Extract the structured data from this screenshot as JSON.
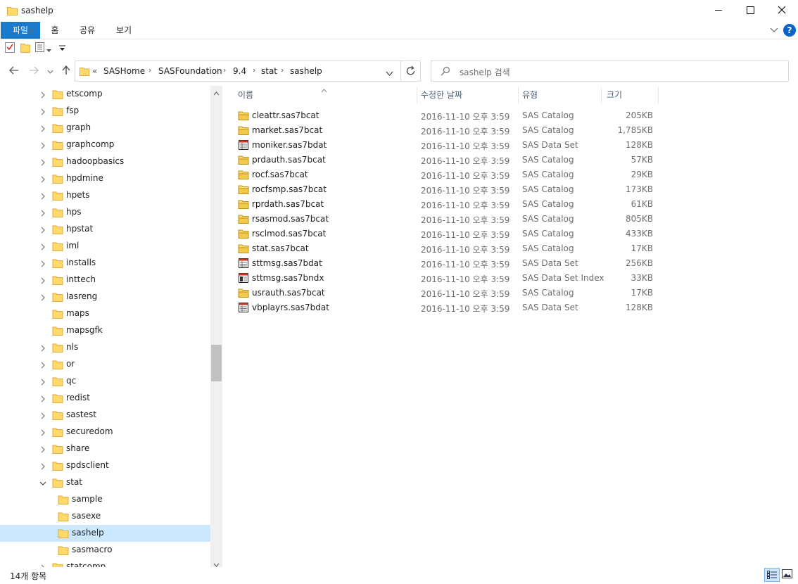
{
  "window": {
    "title": "sashelp",
    "controls": {
      "minimize": "minimize-icon",
      "maximize": "maximize-icon",
      "close": "close-icon"
    }
  },
  "ribbon": {
    "tabs": [
      {
        "label": "파일",
        "active": true
      },
      {
        "label": "홈"
      },
      {
        "label": "공유"
      },
      {
        "label": "보기"
      }
    ],
    "expand_icon": "chevron-down-icon",
    "help_icon": "help-icon",
    "help_label": "?"
  },
  "quick_access": [
    "properties-icon",
    "new-folder-icon",
    "view-options-icon",
    "customize-dropdown-icon"
  ],
  "address": {
    "prefix": "«",
    "breadcrumbs": [
      "SASHome",
      "SASFoundation",
      "9.4",
      "stat",
      "sashelp"
    ]
  },
  "search": {
    "placeholder": "sashelp 검색"
  },
  "nav_tree": [
    {
      "label": "etscomp",
      "expander": true,
      "indent": 0
    },
    {
      "label": "fsp",
      "expander": true,
      "indent": 0
    },
    {
      "label": "graph",
      "expander": true,
      "indent": 0
    },
    {
      "label": "graphcomp",
      "expander": true,
      "indent": 0
    },
    {
      "label": "hadoopbasics",
      "expander": true,
      "indent": 0
    },
    {
      "label": "hpdmine",
      "expander": true,
      "indent": 0
    },
    {
      "label": "hpets",
      "expander": true,
      "indent": 0
    },
    {
      "label": "hps",
      "expander": true,
      "indent": 0
    },
    {
      "label": "hpstat",
      "expander": true,
      "indent": 0
    },
    {
      "label": "iml",
      "expander": true,
      "indent": 0
    },
    {
      "label": "installs",
      "expander": true,
      "indent": 0
    },
    {
      "label": "inttech",
      "expander": true,
      "indent": 0
    },
    {
      "label": "lasreng",
      "expander": true,
      "indent": 0
    },
    {
      "label": "maps",
      "expander": false,
      "indent": 0
    },
    {
      "label": "mapsgfk",
      "expander": false,
      "indent": 0
    },
    {
      "label": "nls",
      "expander": true,
      "indent": 0
    },
    {
      "label": "or",
      "expander": true,
      "indent": 0
    },
    {
      "label": "qc",
      "expander": true,
      "indent": 0
    },
    {
      "label": "redist",
      "expander": true,
      "indent": 0
    },
    {
      "label": "sastest",
      "expander": true,
      "indent": 0
    },
    {
      "label": "securedom",
      "expander": true,
      "indent": 0
    },
    {
      "label": "share",
      "expander": true,
      "indent": 0
    },
    {
      "label": "spdsclient",
      "expander": true,
      "indent": 0
    },
    {
      "label": "stat",
      "expander": true,
      "expanded": true,
      "indent": 0
    },
    {
      "label": "sample",
      "expander": false,
      "indent": 1
    },
    {
      "label": "sasexe",
      "expander": false,
      "indent": 1
    },
    {
      "label": "sashelp",
      "expander": false,
      "indent": 1,
      "selected": true
    },
    {
      "label": "sasmacro",
      "expander": false,
      "indent": 1
    },
    {
      "label": "statcomp",
      "expander": true,
      "indent": 0
    }
  ],
  "columns": {
    "name": "이름",
    "date": "수정한 날짜",
    "type": "유형",
    "size": "크기"
  },
  "files": [
    {
      "name": "cleattr.sas7bcat",
      "date": "2016-11-10 오후 3:59",
      "type": "SAS Catalog",
      "size": "205KB",
      "icon": "sas-catalog-icon"
    },
    {
      "name": "market.sas7bcat",
      "date": "2016-11-10 오후 3:59",
      "type": "SAS Catalog",
      "size": "1,785KB",
      "icon": "sas-catalog-icon"
    },
    {
      "name": "moniker.sas7bdat",
      "date": "2016-11-10 오후 3:59",
      "type": "SAS Data Set",
      "size": "128KB",
      "icon": "sas-dataset-icon"
    },
    {
      "name": "prdauth.sas7bcat",
      "date": "2016-11-10 오후 3:59",
      "type": "SAS Catalog",
      "size": "57KB",
      "icon": "sas-catalog-icon"
    },
    {
      "name": "rocf.sas7bcat",
      "date": "2016-11-10 오후 3:59",
      "type": "SAS Catalog",
      "size": "29KB",
      "icon": "sas-catalog-icon"
    },
    {
      "name": "rocfsmp.sas7bcat",
      "date": "2016-11-10 오후 3:59",
      "type": "SAS Catalog",
      "size": "173KB",
      "icon": "sas-catalog-icon"
    },
    {
      "name": "rprdath.sas7bcat",
      "date": "2016-11-10 오후 3:59",
      "type": "SAS Catalog",
      "size": "61KB",
      "icon": "sas-catalog-icon"
    },
    {
      "name": "rsasmod.sas7bcat",
      "date": "2016-11-10 오후 3:59",
      "type": "SAS Catalog",
      "size": "805KB",
      "icon": "sas-catalog-icon"
    },
    {
      "name": "rsclmod.sas7bcat",
      "date": "2016-11-10 오후 3:59",
      "type": "SAS Catalog",
      "size": "433KB",
      "icon": "sas-catalog-icon"
    },
    {
      "name": "stat.sas7bcat",
      "date": "2016-11-10 오후 3:59",
      "type": "SAS Catalog",
      "size": "17KB",
      "icon": "sas-catalog-icon"
    },
    {
      "name": "sttmsg.sas7bdat",
      "date": "2016-11-10 오후 3:59",
      "type": "SAS Data Set",
      "size": "256KB",
      "icon": "sas-dataset-icon"
    },
    {
      "name": "sttmsg.sas7bndx",
      "date": "2016-11-10 오후 3:59",
      "type": "SAS Data Set Index",
      "size": "33KB",
      "icon": "sas-index-icon"
    },
    {
      "name": "usrauth.sas7bcat",
      "date": "2016-11-10 오후 3:59",
      "type": "SAS Catalog",
      "size": "17KB",
      "icon": "sas-catalog-icon"
    },
    {
      "name": "vbplayrs.sas7bdat",
      "date": "2016-11-10 오후 3:59",
      "type": "SAS Data Set",
      "size": "128KB",
      "icon": "sas-dataset-icon"
    }
  ],
  "status": {
    "item_count": "14개 항목"
  },
  "colors": {
    "accent": "#1979ca",
    "selection": "#cce8ff",
    "folder": "#ffd96b",
    "help": "#0a64c8"
  }
}
